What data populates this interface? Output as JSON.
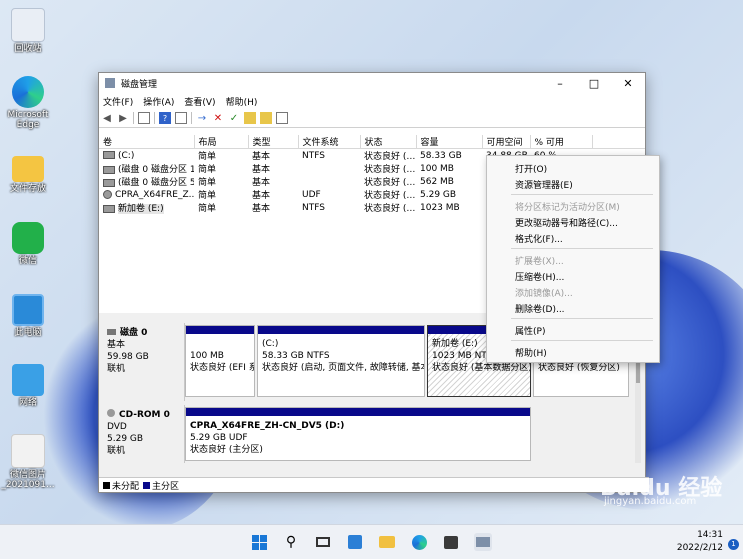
{
  "desktop": {
    "icons": [
      {
        "label": "回收站"
      },
      {
        "label": "Microsoft Edge"
      },
      {
        "label": "文件存放"
      },
      {
        "label": "微信"
      },
      {
        "label": "此电脑"
      },
      {
        "label": "网络"
      },
      {
        "label": "微信图片_2021091..."
      }
    ]
  },
  "window": {
    "title": "磁盘管理",
    "menu": [
      "文件(F)",
      "操作(A)",
      "查看(V)",
      "帮助(H)"
    ],
    "columns": [
      "卷",
      "布局",
      "类型",
      "文件系统",
      "状态",
      "容量",
      "可用空间",
      "% 可用"
    ],
    "rows": [
      {
        "vol": "(C:)",
        "layout": "简单",
        "type": "基本",
        "fs": "NTFS",
        "status": "状态良好 (…",
        "cap": "58.33 GB",
        "free": "34.88 GB",
        "pct": "60 %"
      },
      {
        "vol": "(磁盘 0 磁盘分区 1)",
        "layout": "简单",
        "type": "基本",
        "fs": "",
        "status": "状态良好 (…",
        "cap": "100 MB",
        "free": "",
        "pct": ""
      },
      {
        "vol": "(磁盘 0 磁盘分区 5)",
        "layout": "简单",
        "type": "基本",
        "fs": "",
        "status": "状态良好 (…",
        "cap": "562 MB",
        "free": "",
        "pct": ""
      },
      {
        "vol": "CPRA_X64FRE_Z...",
        "layout": "简单",
        "type": "基本",
        "fs": "UDF",
        "status": "状态良好 (…",
        "cap": "5.29 GB",
        "free": "",
        "pct": ""
      },
      {
        "vol": "新加卷 (E:)",
        "layout": "简单",
        "type": "基本",
        "fs": "NTFS",
        "status": "状态良好 (…",
        "cap": "1023 MB",
        "free": "",
        "pct": ""
      }
    ],
    "disk0": {
      "name": "磁盘 0",
      "type": "基本",
      "size": "59.98 GB",
      "state": "联机",
      "parts": [
        {
          "line1": "",
          "line2": "100 MB",
          "line3": "状态良好 (EFI 系"
        },
        {
          "line1": "(C:)",
          "line2": "58.33 GB NTFS",
          "line3": "状态良好 (启动, 页面文件, 故障转储, 基本"
        },
        {
          "line1": "新加卷 (E:)",
          "line2": "1023 MB NTFS",
          "line3": "状态良好 (基本数据分区)"
        },
        {
          "line1": "",
          "line2": "",
          "line3": "状态良好 (恢复分区)"
        }
      ]
    },
    "cdrom": {
      "name": "CD-ROM 0",
      "type": "DVD",
      "size": "5.29 GB",
      "state": "联机",
      "part": {
        "line1": "CPRA_X64FRE_ZH-CN_DV5 (D:)",
        "line2": "5.29 GB UDF",
        "line3": "状态良好 (主分区)"
      }
    },
    "legend": [
      "未分配",
      "主分区"
    ]
  },
  "context_menu": {
    "items": [
      {
        "label": "打开(O)",
        "enabled": true
      },
      {
        "label": "资源管理器(E)",
        "enabled": true
      },
      {
        "label": "将分区标记为活动分区(M)",
        "enabled": false
      },
      {
        "label": "更改驱动器号和路径(C)...",
        "enabled": true
      },
      {
        "label": "格式化(F)...",
        "enabled": true
      },
      {
        "label": "扩展卷(X)...",
        "enabled": false
      },
      {
        "label": "压缩卷(H)...",
        "enabled": true
      },
      {
        "label": "添加镜像(A)...",
        "enabled": false
      },
      {
        "label": "删除卷(D)...",
        "enabled": true
      },
      {
        "label": "属性(P)",
        "enabled": true
      },
      {
        "label": "帮助(H)",
        "enabled": true
      }
    ]
  },
  "taskbar": {
    "time": "14:31",
    "date": "2022/2/12",
    "notification_count": "1"
  },
  "watermark": {
    "brand": "Baidu 经验",
    "url": "jingyan.baidu.com"
  }
}
